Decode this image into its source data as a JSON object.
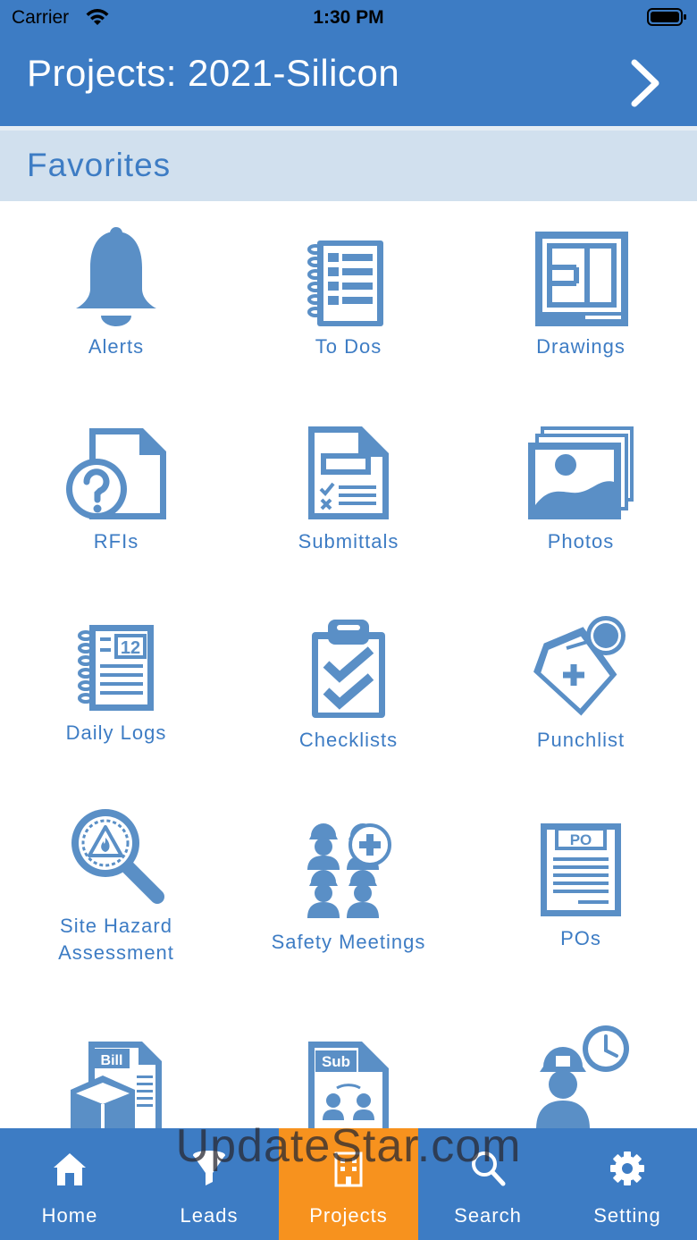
{
  "status_bar": {
    "carrier": "Carrier",
    "time": "1:30 PM"
  },
  "header": {
    "title": "Projects: 2021-Silicon"
  },
  "section": {
    "label": "Favorites"
  },
  "tiles": [
    {
      "label": "Alerts",
      "icon": "bell-icon"
    },
    {
      "label": "To Dos",
      "icon": "todo-list-icon"
    },
    {
      "label": "Drawings",
      "icon": "drawings-icon"
    },
    {
      "label": "RFIs",
      "icon": "rfi-icon"
    },
    {
      "label": "Submittals",
      "icon": "submittals-icon"
    },
    {
      "label": "Photos",
      "icon": "photos-icon"
    },
    {
      "label": "Daily Logs",
      "icon": "daily-logs-icon"
    },
    {
      "label": "Checklists",
      "icon": "checklists-icon"
    },
    {
      "label": "Punchlist",
      "icon": "punchlist-icon"
    },
    {
      "label": "Site Hazard Assessment",
      "icon": "site-hazard-icon"
    },
    {
      "label": "Safety Meetings",
      "icon": "safety-meetings-icon"
    },
    {
      "label": "POs",
      "icon": "po-icon"
    },
    {
      "label": "",
      "icon": "bills-icon",
      "icon_text": "Bill"
    },
    {
      "label": "",
      "icon": "subcontracts-icon",
      "icon_text": "Sub"
    },
    {
      "label": "",
      "icon": "timesheets-icon"
    }
  ],
  "po_icon_text": "PO",
  "daily_log_icon_text": "12",
  "tab_bar": [
    {
      "label": "Home",
      "icon": "home-icon",
      "active": false
    },
    {
      "label": "Leads",
      "icon": "funnel-icon",
      "active": false
    },
    {
      "label": "Projects",
      "icon": "building-icon",
      "active": true
    },
    {
      "label": "Search",
      "icon": "search-icon",
      "active": false
    },
    {
      "label": "Setting",
      "icon": "gear-icon",
      "active": false
    }
  ],
  "watermark": "UpdateStar.com",
  "colors": {
    "brand_blue": "#3d7cc4",
    "icon_blue": "#5a8fc6",
    "section_bg": "#d1e0ee",
    "active_tab": "#f7921e"
  }
}
